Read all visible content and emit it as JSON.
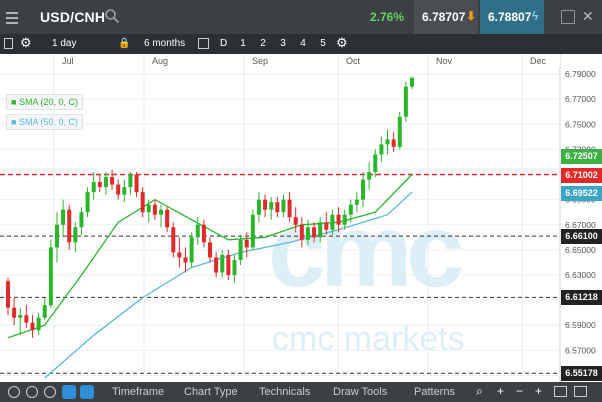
{
  "header": {
    "symbol": "USD/CNH",
    "change_pct": "2.76%",
    "sell_price": "6.78707",
    "buy_price": "6.78807",
    "icons": [
      "menu-grip-icon",
      "search-icon",
      "arrow-down-icon",
      "lightning-icon",
      "popout-icon",
      "close-icon"
    ]
  },
  "toolbar": {
    "interval": "1 day",
    "range": "6 months",
    "draw_label": "D",
    "presets": [
      "1",
      "2",
      "3",
      "4",
      "5"
    ]
  },
  "chart": {
    "months": [
      "Jul",
      "Aug",
      "Sep",
      "Oct",
      "Nov",
      "Dec"
    ],
    "y_ticks": [
      "6.79000",
      "6.77000",
      "6.75000",
      "6.73000",
      "6.71000",
      "6.69000",
      "6.67000",
      "6.65000",
      "6.63000",
      "6.61000",
      "6.59000",
      "6.57000",
      "6.55000"
    ],
    "legend": [
      {
        "label": "SMA (20, 0, C)",
        "color": "#2bb52b"
      },
      {
        "label": "SMA (50, 0, C)",
        "color": "#5bb8d6"
      }
    ],
    "price_labels": [
      {
        "value": "6.72507",
        "bg": "#3cb043",
        "fg": "#ffffff"
      },
      {
        "value": "6.71002",
        "bg": "#e02a2a",
        "fg": "#ffffff"
      },
      {
        "value": "6.69522",
        "bg": "#3aa6c4",
        "fg": "#ffffff"
      },
      {
        "value": "6.66100",
        "bg": "#222222",
        "fg": "#ffffff"
      },
      {
        "value": "6.61218",
        "bg": "#222222",
        "fg": "#ffffff"
      },
      {
        "value": "6.55178",
        "bg": "#222222",
        "fg": "#ffffff"
      }
    ],
    "watermark": {
      "logo_text": "cmc",
      "name": "cmc markets"
    }
  },
  "chart_data": {
    "type": "candlestick",
    "y_range": [
      6.548,
      6.798
    ],
    "candle_colors": {
      "up": "#2bb52b",
      "down": "#e02a2a"
    },
    "candles": [
      [
        6.625,
        6.628,
        6.598,
        6.604
      ],
      [
        6.604,
        6.612,
        6.59,
        6.596
      ],
      [
        6.596,
        6.604,
        6.582,
        6.598
      ],
      [
        6.598,
        6.606,
        6.588,
        6.592
      ],
      [
        6.592,
        6.598,
        6.58,
        6.586
      ],
      [
        6.586,
        6.6,
        6.582,
        6.596
      ],
      [
        6.596,
        6.612,
        6.594,
        6.606
      ],
      [
        6.606,
        6.658,
        6.604,
        6.652
      ],
      [
        6.652,
        6.68,
        6.64,
        6.67
      ],
      [
        6.67,
        6.69,
        6.66,
        6.682
      ],
      [
        6.682,
        6.686,
        6.65,
        6.656
      ],
      [
        6.656,
        6.672,
        6.648,
        6.668
      ],
      [
        6.668,
        6.684,
        6.662,
        6.68
      ],
      [
        6.68,
        6.7,
        6.676,
        6.696
      ],
      [
        6.696,
        6.712,
        6.69,
        6.704
      ],
      [
        6.704,
        6.71,
        6.696,
        6.7
      ],
      [
        6.7,
        6.712,
        6.694,
        6.708
      ],
      [
        6.708,
        6.714,
        6.698,
        6.702
      ],
      [
        6.702,
        6.706,
        6.69,
        6.694
      ],
      [
        6.694,
        6.706,
        6.688,
        6.7
      ],
      [
        6.7,
        6.712,
        6.694,
        6.71
      ],
      [
        6.71,
        6.712,
        6.692,
        6.696
      ],
      [
        6.696,
        6.7,
        6.676,
        6.68
      ],
      [
        6.68,
        6.69,
        6.672,
        6.686
      ],
      [
        6.686,
        6.69,
        6.674,
        6.678
      ],
      [
        6.678,
        6.686,
        6.668,
        6.682
      ],
      [
        6.682,
        6.684,
        6.664,
        6.668
      ],
      [
        6.668,
        6.672,
        6.644,
        6.648
      ],
      [
        6.648,
        6.66,
        6.636,
        6.644
      ],
      [
        6.644,
        6.652,
        6.632,
        6.64
      ],
      [
        6.64,
        6.664,
        6.636,
        6.66
      ],
      [
        6.66,
        6.676,
        6.654,
        6.67
      ],
      [
        6.67,
        6.674,
        6.652,
        6.656
      ],
      [
        6.656,
        6.66,
        6.64,
        6.644
      ],
      [
        6.644,
        6.648,
        6.628,
        6.632
      ],
      [
        6.632,
        6.65,
        6.628,
        6.646
      ],
      [
        6.646,
        6.65,
        6.626,
        6.63
      ],
      [
        6.63,
        6.646,
        6.624,
        6.642
      ],
      [
        6.642,
        6.662,
        6.638,
        6.658
      ],
      [
        6.658,
        6.664,
        6.644,
        6.652
      ],
      [
        6.652,
        6.682,
        6.65,
        6.678
      ],
      [
        6.678,
        6.696,
        6.672,
        6.69
      ],
      [
        6.69,
        6.694,
        6.676,
        6.682
      ],
      [
        6.682,
        6.692,
        6.674,
        6.688
      ],
      [
        6.688,
        6.692,
        6.676,
        6.68
      ],
      [
        6.68,
        6.694,
        6.676,
        6.69
      ],
      [
        6.69,
        6.696,
        6.672,
        6.676
      ],
      [
        6.676,
        6.684,
        6.664,
        6.67
      ],
      [
        6.67,
        6.676,
        6.652,
        6.658
      ],
      [
        6.658,
        6.674,
        6.654,
        6.668
      ],
      [
        6.668,
        6.672,
        6.656,
        6.66
      ],
      [
        6.66,
        6.676,
        6.656,
        6.672
      ],
      [
        6.672,
        6.68,
        6.662,
        6.666
      ],
      [
        6.666,
        6.682,
        6.662,
        6.678
      ],
      [
        6.678,
        6.684,
        6.664,
        6.67
      ],
      [
        6.67,
        6.682,
        6.666,
        6.678
      ],
      [
        6.678,
        6.69,
        6.672,
        6.686
      ],
      [
        6.686,
        6.696,
        6.68,
        6.69
      ],
      [
        6.69,
        6.712,
        6.684,
        6.706
      ],
      [
        6.706,
        6.72,
        6.698,
        6.712
      ],
      [
        6.712,
        6.73,
        6.708,
        6.726
      ],
      [
        6.726,
        6.74,
        6.72,
        6.734
      ],
      [
        6.734,
        6.746,
        6.726,
        6.738
      ],
      [
        6.738,
        6.744,
        6.728,
        6.732
      ],
      [
        6.732,
        6.76,
        6.73,
        6.756
      ],
      [
        6.756,
        6.784,
        6.752,
        6.78
      ],
      [
        6.78,
        6.788,
        6.778,
        6.787
      ]
    ],
    "sma20": [
      [
        0,
        6.58
      ],
      [
        6,
        6.59
      ],
      [
        12,
        6.63
      ],
      [
        18,
        6.672
      ],
      [
        24,
        6.69
      ],
      [
        30,
        6.674
      ],
      [
        36,
        6.658
      ],
      [
        42,
        6.66
      ],
      [
        48,
        6.67
      ],
      [
        54,
        6.672
      ],
      [
        60,
        6.68
      ],
      [
        66,
        6.71
      ]
    ],
    "sma50": [
      [
        6,
        6.548
      ],
      [
        14,
        6.582
      ],
      [
        22,
        6.612
      ],
      [
        30,
        6.636
      ],
      [
        38,
        6.648
      ],
      [
        46,
        6.656
      ],
      [
        54,
        6.666
      ],
      [
        62,
        6.678
      ],
      [
        66,
        6.696
      ]
    ]
  },
  "bottom": {
    "tabs": [
      "Timeframe",
      "Chart Type",
      "Technicals",
      "Draw Tools",
      "Patterns"
    ],
    "zoom": [
      "+",
      "−",
      "+"
    ]
  }
}
